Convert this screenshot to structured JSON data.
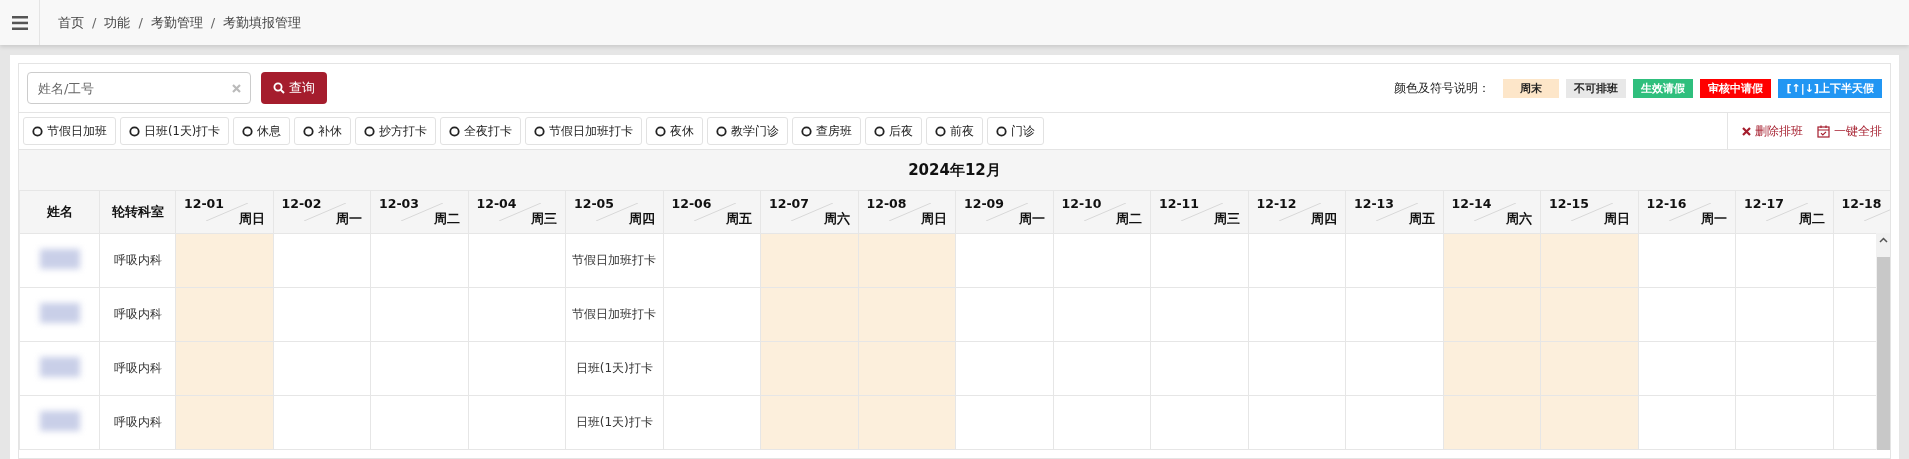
{
  "breadcrumb": {
    "separator": "/",
    "items": [
      "首页",
      "功能",
      "考勤管理",
      "考勤填报管理"
    ]
  },
  "search": {
    "placeholder": "姓名/工号",
    "button": "查询"
  },
  "legend": {
    "title": "颜色及符号说明：",
    "items": [
      {
        "label": "周末",
        "color": "#fde6c9"
      },
      {
        "label": "不可排班",
        "color": "#e8e8e8"
      },
      {
        "label": "生效请假",
        "color": "#2fbf7d"
      },
      {
        "label": "审核中请假",
        "color": "#ff0000"
      },
      {
        "label": "[↑|↓]上下半天假",
        "color": "#2196f3"
      }
    ]
  },
  "shifts": [
    {
      "label": "节假日加班",
      "selected": false
    },
    {
      "label": "日班(1天)打卡",
      "selected": false
    },
    {
      "label": "休息",
      "selected": false
    },
    {
      "label": "补休",
      "selected": false
    },
    {
      "label": "抄方打卡",
      "selected": false
    },
    {
      "label": "全夜打卡",
      "selected": false
    },
    {
      "label": "节假日加班打卡",
      "selected": false
    },
    {
      "label": "夜休",
      "selected": false
    },
    {
      "label": "教学门诊",
      "selected": false
    },
    {
      "label": "查房班",
      "selected": false
    },
    {
      "label": "后夜",
      "selected": false
    },
    {
      "label": "前夜",
      "selected": false
    },
    {
      "label": "门诊",
      "selected": false
    }
  ],
  "actions": [
    {
      "kind": "delete",
      "label": "删除排班"
    },
    {
      "kind": "schedule",
      "label": "一键全排"
    }
  ],
  "table": {
    "month": "2024年12月",
    "columns": [
      "姓名",
      "轮转科室"
    ],
    "dates": [
      {
        "date": "12-01",
        "weekday": "周日",
        "weekend": true
      },
      {
        "date": "12-02",
        "weekday": "周一",
        "weekend": false
      },
      {
        "date": "12-03",
        "weekday": "周二",
        "weekend": false
      },
      {
        "date": "12-04",
        "weekday": "周三",
        "weekend": false
      },
      {
        "date": "12-05",
        "weekday": "周四",
        "weekend": false
      },
      {
        "date": "12-06",
        "weekday": "周五",
        "weekend": false
      },
      {
        "date": "12-07",
        "weekday": "周六",
        "weekend": true
      },
      {
        "date": "12-08",
        "weekday": "周日",
        "weekend": true
      },
      {
        "date": "12-09",
        "weekday": "周一",
        "weekend": false
      },
      {
        "date": "12-10",
        "weekday": "周二",
        "weekend": false
      },
      {
        "date": "12-11",
        "weekday": "周三",
        "weekend": false
      },
      {
        "date": "12-12",
        "weekday": "周四",
        "weekend": false
      },
      {
        "date": "12-13",
        "weekday": "周五",
        "weekend": false
      },
      {
        "date": "12-14",
        "weekday": "周六",
        "weekend": true
      },
      {
        "date": "12-15",
        "weekday": "周日",
        "weekend": true
      },
      {
        "date": "12-16",
        "weekday": "周一",
        "weekend": false
      },
      {
        "date": "12-17",
        "weekday": "周二",
        "weekend": false
      },
      {
        "date": "12-18",
        "weekend": false
      }
    ],
    "rows": [
      {
        "dept": "呼吸内科",
        "cells": [
          {},
          {},
          {},
          {},
          {
            "text": "节假日加班打卡"
          },
          {},
          {},
          {},
          {},
          {},
          {},
          {},
          {},
          {},
          {},
          {},
          {},
          {}
        ]
      },
      {
        "dept": "呼吸内科",
        "cells": [
          {},
          {},
          {},
          {},
          {
            "text": "节假日加班打卡"
          },
          {},
          {},
          {},
          {},
          {},
          {},
          {},
          {},
          {},
          {},
          {},
          {},
          {}
        ]
      },
      {
        "dept": "呼吸内科",
        "cells": [
          {},
          {},
          {},
          {},
          {
            "text": "日班(1天)打卡"
          },
          {},
          {},
          {},
          {},
          {},
          {},
          {},
          {},
          {},
          {},
          {},
          {},
          {}
        ]
      },
      {
        "dept": "呼吸内科",
        "cells": [
          {},
          {},
          {},
          {},
          {
            "text": "日班(1天)打卡"
          },
          {},
          {},
          {},
          {},
          {},
          {},
          {},
          {},
          {},
          {},
          {},
          {},
          {}
        ]
      }
    ]
  }
}
